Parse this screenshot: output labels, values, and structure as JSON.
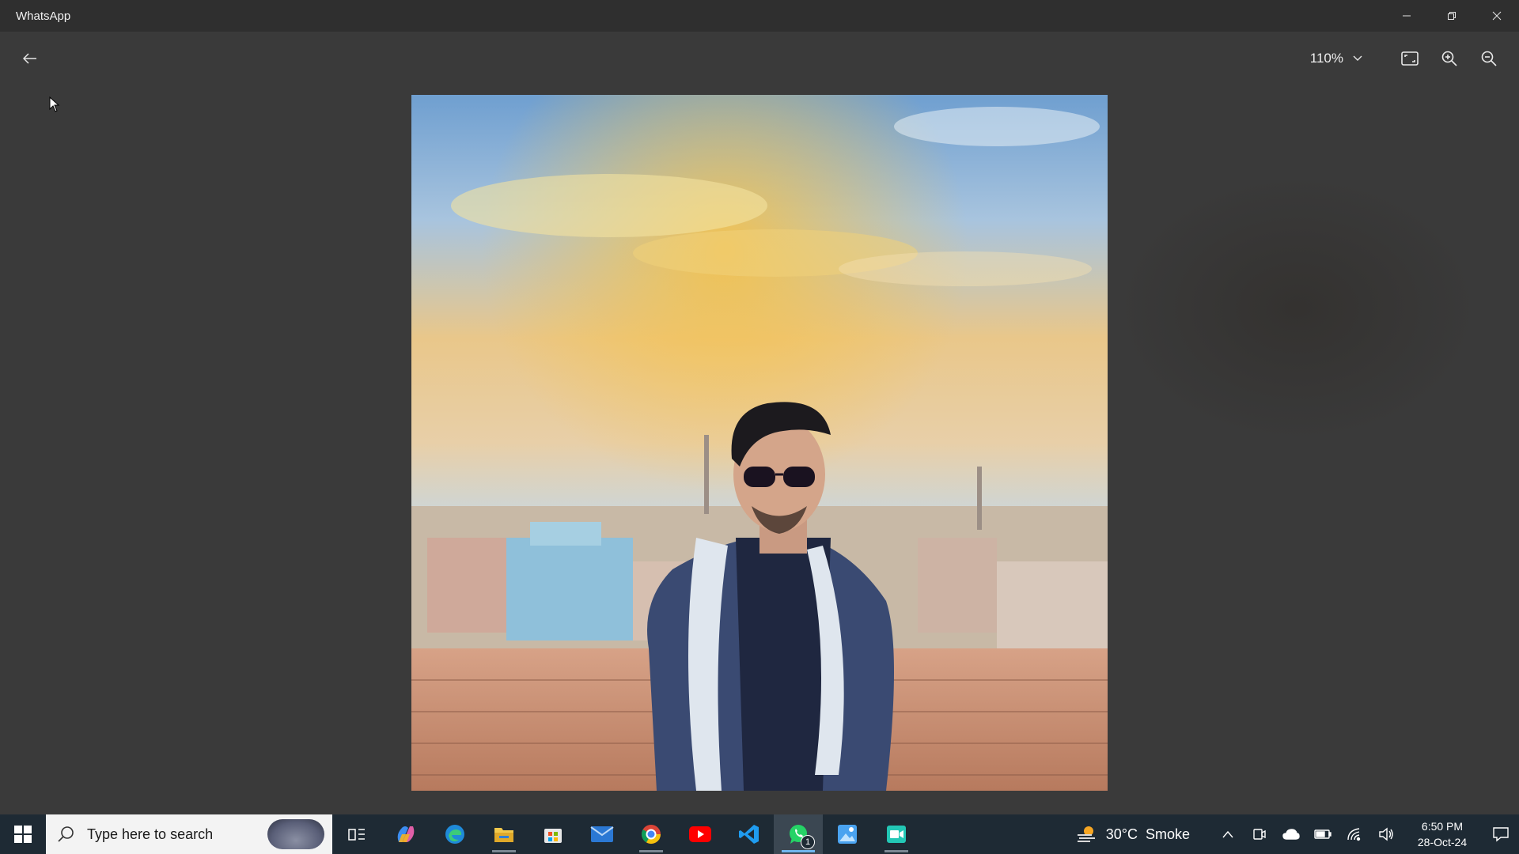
{
  "window": {
    "title": "WhatsApp"
  },
  "viewer": {
    "zoom_level": "110%",
    "back_icon": "arrow-left-icon",
    "tools": [
      "fit-to-screen-icon",
      "zoom-in-icon",
      "zoom-out-icon"
    ]
  },
  "photo": {
    "subject": "portrait photo"
  },
  "taskbar": {
    "search_placeholder": "Type here to search",
    "pinned_apps": [
      "task-view",
      "copilot",
      "edge",
      "file-explorer",
      "microsoft-store",
      "mail",
      "chrome",
      "youtube",
      "vs-code",
      "whatsapp",
      "photos-editor",
      "screen-recorder"
    ],
    "whatsapp_badge": "1",
    "weather": {
      "temperature": "30°C",
      "condition": "Smoke"
    },
    "clock": {
      "time": "6:50 PM",
      "date": "28-Oct-24"
    }
  },
  "colors": {
    "titlebar": "#2f2f2f",
    "viewer_bg": "#3a3a3a",
    "taskbar": "#1e2a34",
    "accent": "#6fb6ee"
  }
}
